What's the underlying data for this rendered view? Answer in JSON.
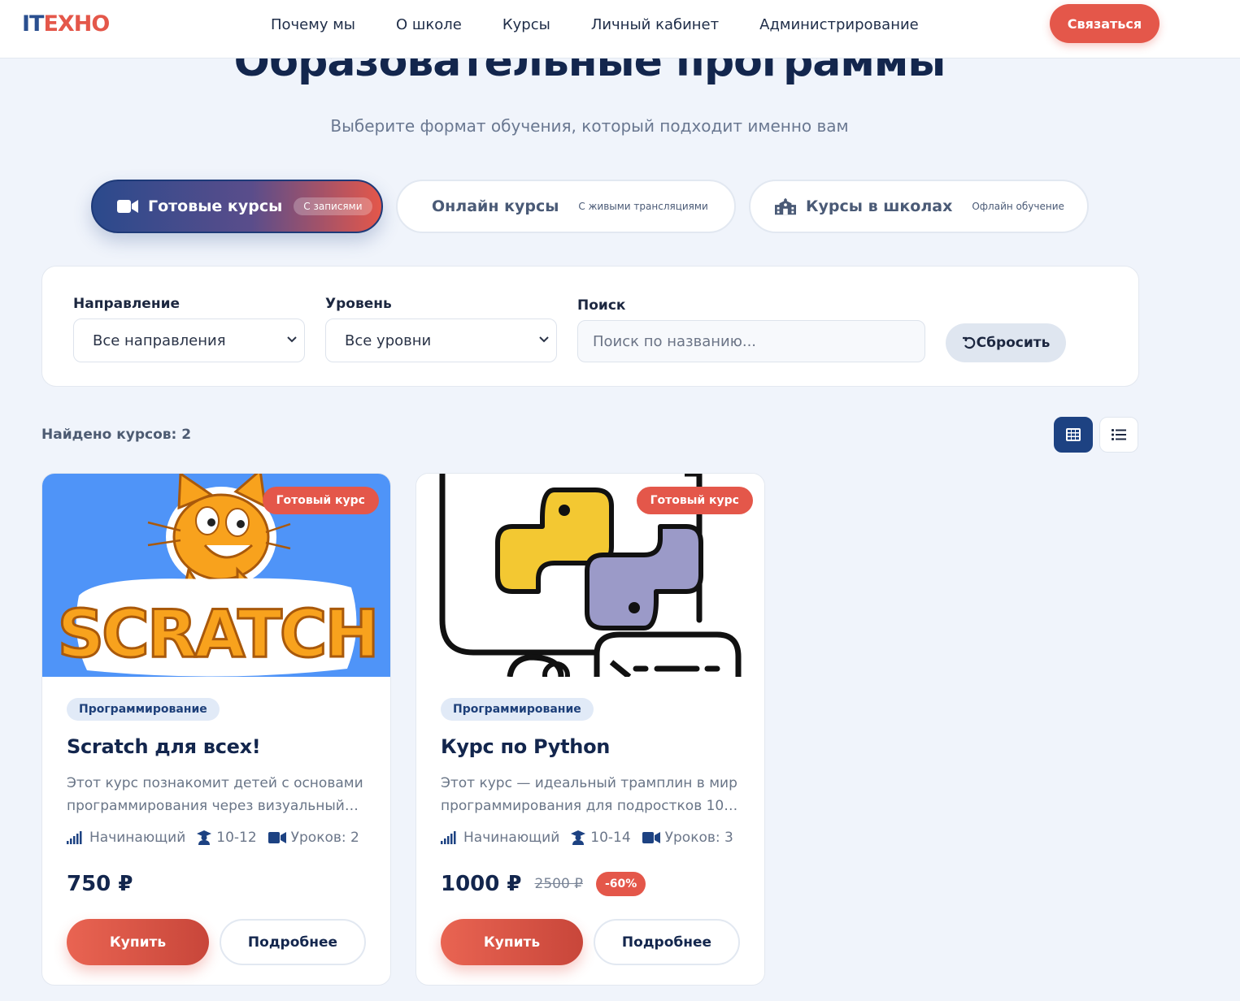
{
  "header": {
    "logo_part1": "IT",
    "logo_part2": "ЕХНО",
    "nav": [
      "Почему мы",
      "О школе",
      "Курсы",
      "Личный кабинет",
      "Администрирование"
    ],
    "contact_label": "Связаться"
  },
  "hero": {
    "title": "Образовательные программы",
    "subtitle": "Выберите формат обучения, который подходит именно вам"
  },
  "tabs": [
    {
      "label": "Готовые курсы",
      "sub": "С записями",
      "icon": "video-camera-icon",
      "active": true
    },
    {
      "label": "Онлайн курсы",
      "sub": "С живыми трансляциями",
      "icon": "",
      "active": false
    },
    {
      "label": "Курсы в школах",
      "sub": "Офлайн обучение",
      "icon": "school-building-icon",
      "active": false
    }
  ],
  "filters": {
    "direction_label": "Направление",
    "direction_value": "Все направления",
    "level_label": "Уровень",
    "level_value": "Все уровни",
    "search_label": "Поиск",
    "search_placeholder": "Поиск по названию...",
    "reset_label": "Сбросить"
  },
  "results": {
    "found_text": "Найдено курсов: 2"
  },
  "colors": {
    "brand_blue": "#1d4282",
    "accent_red": "#e4574a",
    "page_bg": "#f0f4fb"
  },
  "courses": [
    {
      "badge": "Готовый курс",
      "category": "Программирование",
      "title": "Scratch для всех!",
      "desc_line1": "Этот курс познакомит детей с основами",
      "desc_line2": "программирования через визуальный…",
      "level": "Начинающий",
      "age": "10-12",
      "lessons": "Уроков: 2",
      "price": "750 ₽",
      "old_price": "",
      "discount": "",
      "buy_label": "Купить",
      "more_label": "Подробнее",
      "image_text": "SCRATCH"
    },
    {
      "badge": "Готовый курс",
      "category": "Программирование",
      "title": "Курс по Python",
      "desc_line1": "Этот курс — идеальный трамплин в мир",
      "desc_line2": "программирования для подростков 10–…",
      "level": "Начинающий",
      "age": "10-14",
      "lessons": "Уроков: 3",
      "price": "1000 ₽",
      "old_price": "2500 ₽",
      "discount": "-60%",
      "buy_label": "Купить",
      "more_label": "Подробнее"
    }
  ]
}
